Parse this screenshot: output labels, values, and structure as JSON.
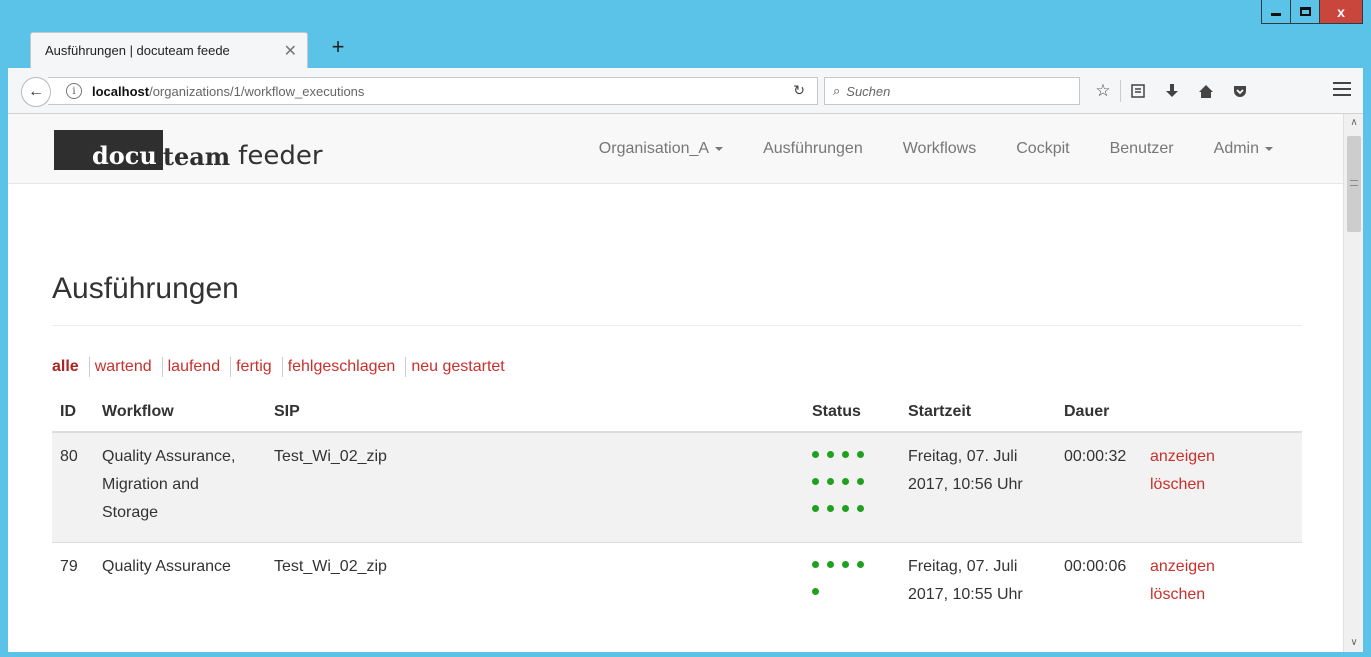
{
  "window": {
    "minimize": "−",
    "maximize": "□",
    "close": "x"
  },
  "tab": {
    "title": "Ausführungen | docuteam feede",
    "close": "✕",
    "new_tab": "+"
  },
  "address": {
    "host": "localhost",
    "path": "/organizations/1/workflow_executions",
    "reload": "C"
  },
  "search": {
    "placeholder": "Suchen"
  },
  "toolbar_icons": [
    "bookmark-star-icon",
    "reading-list-icon",
    "download-icon",
    "home-icon",
    "pocket-icon"
  ],
  "site": {
    "brand_dark": "docu",
    "brand_team": "team",
    "brand_feeder": "feeder",
    "nav": [
      {
        "label": "Organisation_A",
        "dropdown": true
      },
      {
        "label": "Ausführungen",
        "dropdown": false
      },
      {
        "label": "Workflows",
        "dropdown": false
      },
      {
        "label": "Cockpit",
        "dropdown": false
      },
      {
        "label": "Benutzer",
        "dropdown": false
      },
      {
        "label": "Admin",
        "dropdown": true
      }
    ]
  },
  "page": {
    "title": "Ausführungen",
    "filters": [
      "alle",
      "wartend",
      "laufend",
      "fertig",
      "fehlgeschlagen",
      "neu gestartet"
    ],
    "active_filter": "alle",
    "columns": [
      "ID",
      "Workflow",
      "SIP",
      "Status",
      "Startzeit",
      "Dauer",
      ""
    ],
    "rows": [
      {
        "id": "80",
        "workflow": "Quality Assurance, Migration and Storage",
        "sip": "Test_Wi_02_zip",
        "status_dots": 12,
        "startzeit": "Freitag, 07. Juli 2017, 10:56 Uhr",
        "dauer": "00:00:32",
        "show": "anzeigen",
        "delete": "löschen"
      },
      {
        "id": "79",
        "workflow": "Quality Assurance",
        "sip": "Test_Wi_02_zip",
        "status_dots": 5,
        "startzeit": "Freitag, 07. Juli 2017, 10:55 Uhr",
        "dauer": "00:00:06",
        "show": "anzeigen",
        "delete": "löschen"
      }
    ]
  },
  "colors": {
    "accent_red": "#c9302c",
    "status_green": "#1fa01f",
    "frame_blue": "#5cc3e8"
  }
}
